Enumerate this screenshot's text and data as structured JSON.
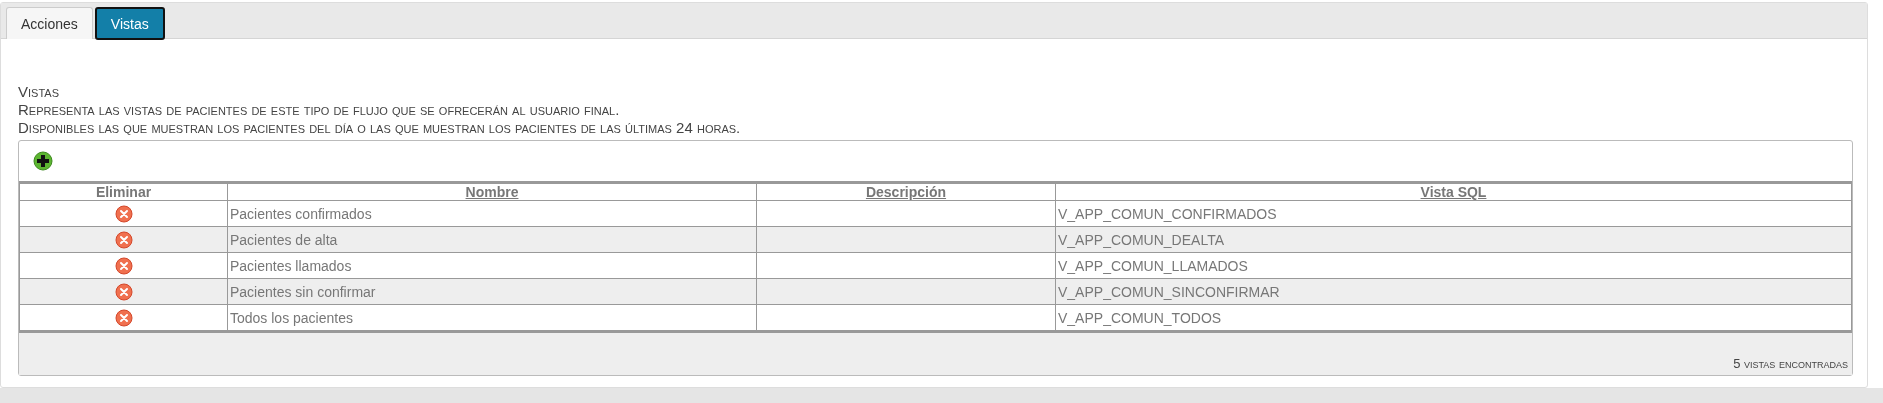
{
  "tabs": [
    {
      "label": "Acciones",
      "selected": false
    },
    {
      "label": "Vistas",
      "selected": true
    }
  ],
  "section": {
    "title": "Vistas",
    "lines": [
      "Representa las vistas de pacientes de este tipo de flujo que se ofrecerán al usuario final.",
      "Disponibles las que muestran los pacientes del día o las que muestran los pacientes de las últimas 24 horas."
    ]
  },
  "table": {
    "columns": [
      {
        "label": "Eliminar",
        "sortable": false
      },
      {
        "label": "Nombre",
        "sortable": true
      },
      {
        "label": "Descripción",
        "sortable": true
      },
      {
        "label": "Vista SQL",
        "sortable": true
      }
    ],
    "rows": [
      {
        "nombre": "Pacientes confirmados",
        "vista_sql": "V_APP_COMUN_CONFIRMADOS"
      },
      {
        "nombre": "Pacientes de alta",
        "vista_sql": "V_APP_COMUN_DEALTA"
      },
      {
        "nombre": "Pacientes llamados",
        "vista_sql": "V_APP_COMUN_LLAMADOS"
      },
      {
        "nombre": "Pacientes sin confirmar",
        "vista_sql": "V_APP_COMUN_SINCONFIRMAR"
      },
      {
        "nombre": "Todos los pacientes",
        "vista_sql": "V_APP_COMUN_TODOS"
      }
    ],
    "footer": "5 vistas encontradas"
  }
}
